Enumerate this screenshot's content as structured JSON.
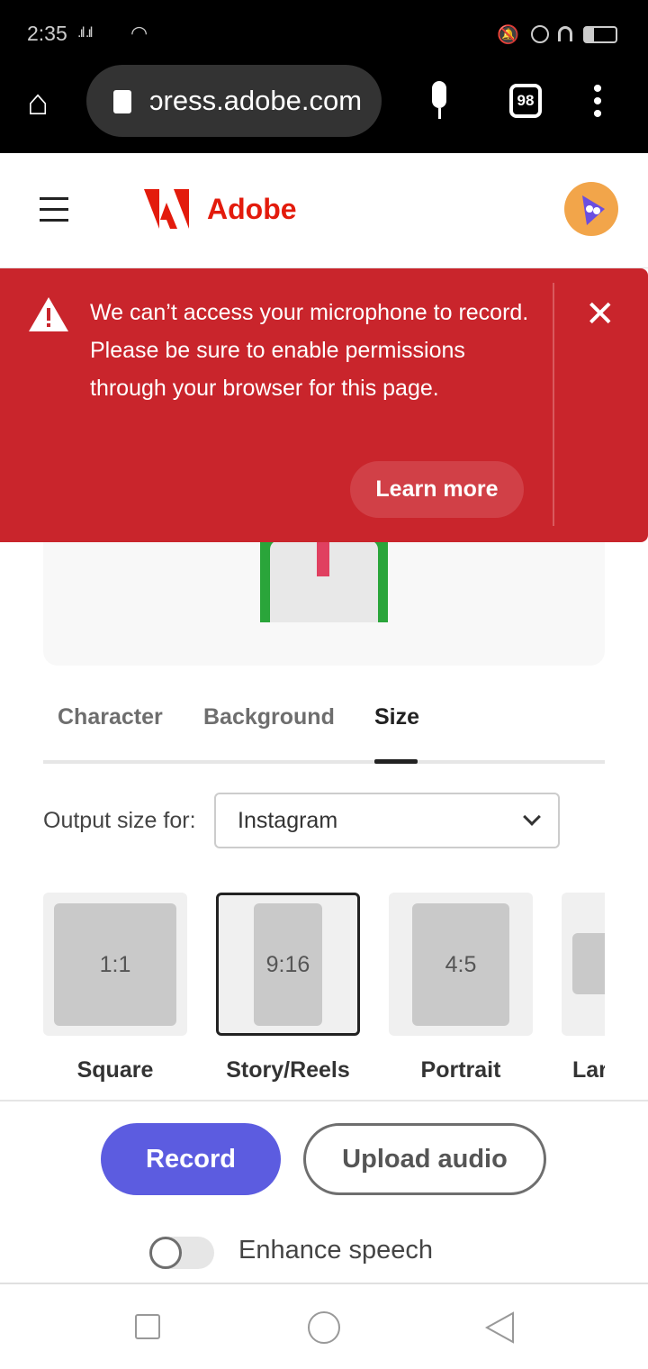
{
  "status_bar": {
    "time": "2:35",
    "signal": ".ıl .ıl",
    "battery_level": 0.3
  },
  "browser": {
    "url": "ɔress.adobe.com",
    "tab_count": "98"
  },
  "header": {
    "brand": "Adobe",
    "brand_color": "#e31b0c"
  },
  "banner": {
    "message": "We can’t access your microphone to record. Please be sure to enable permissions through your browser for this page.",
    "learn_more": "Learn more",
    "color": "#c9252c"
  },
  "tabs": [
    {
      "label": "Character"
    },
    {
      "label": "Background"
    },
    {
      "label": "Size",
      "active": true
    }
  ],
  "output": {
    "label": "Output size for:",
    "value": "Instagram"
  },
  "sizes": [
    {
      "ratio": "1:1",
      "label": "Square"
    },
    {
      "ratio": "9:16",
      "label": "Story/Reels",
      "selected": true
    },
    {
      "ratio": "4:5",
      "label": "Portrait"
    },
    {
      "ratio": "",
      "label": "Lar"
    }
  ],
  "actions": {
    "record": "Record",
    "upload": "Upload audio",
    "accent": "#5c5ce0"
  },
  "enhance": {
    "label": "Enhance speech",
    "on": false
  }
}
